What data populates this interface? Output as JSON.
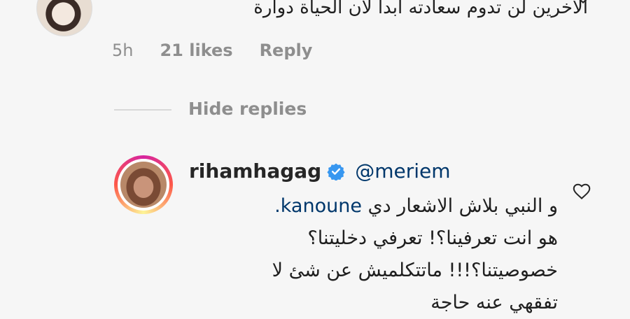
{
  "top_comment": {
    "text": "الآخرين لن تدوم سعادته أبدا لأن الحياة دوارة",
    "time": "5h",
    "likes": "21 likes",
    "reply_label": "Reply"
  },
  "replies": {
    "toggle_label": "Hide replies"
  },
  "reply_comment": {
    "username": "rihamhagag",
    "mention": "@meriem",
    "line1_text": "و النبي بلاش الاشعار دي ",
    "line1_mention": "kanoune.",
    "line2": "هو انت تعرفينا؟! تعرفي دخليتنا؟",
    "line3": "خصوصيتنا؟!!! ماتتكلميش عن شئ لا",
    "line4": "تفقهي عنه حاجة"
  },
  "icons": {
    "heart": "heart-outline-icon",
    "verified": "verified-badge-icon",
    "verified_color": "#3897f0"
  }
}
